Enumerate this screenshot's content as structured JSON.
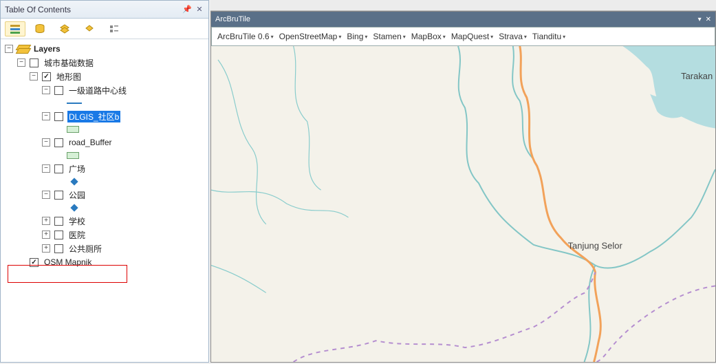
{
  "toc": {
    "title": "Table Of Contents",
    "root_label": "Layers",
    "group1": {
      "label": "城市基础数据",
      "checked": false,
      "expanded": true
    },
    "group2": {
      "label": "地形图",
      "checked": true,
      "expanded": true
    },
    "items": {
      "road_center": "一级道路中心线",
      "dlgis": "DLGIS_社区b",
      "road_buffer": "road_Buffer",
      "plaza": "广场",
      "park": "公园",
      "school": "学校",
      "hospital": "医院",
      "toilet": "公共厕所"
    },
    "osm": {
      "label": "OSM Mapnik",
      "checked": true
    }
  },
  "arcbrutile": {
    "title": "ArcBruTile",
    "menu": {
      "version": "ArcBruTile 0.6",
      "osm": "OpenStreetMap",
      "bing": "Bing",
      "stamen": "Stamen",
      "mapbox": "MapBox",
      "mapquest": "MapQuest",
      "strava": "Strava",
      "tianditu": "Tianditu"
    }
  },
  "map": {
    "city1": "Tanjung Selor",
    "city2": "Tarakan"
  }
}
